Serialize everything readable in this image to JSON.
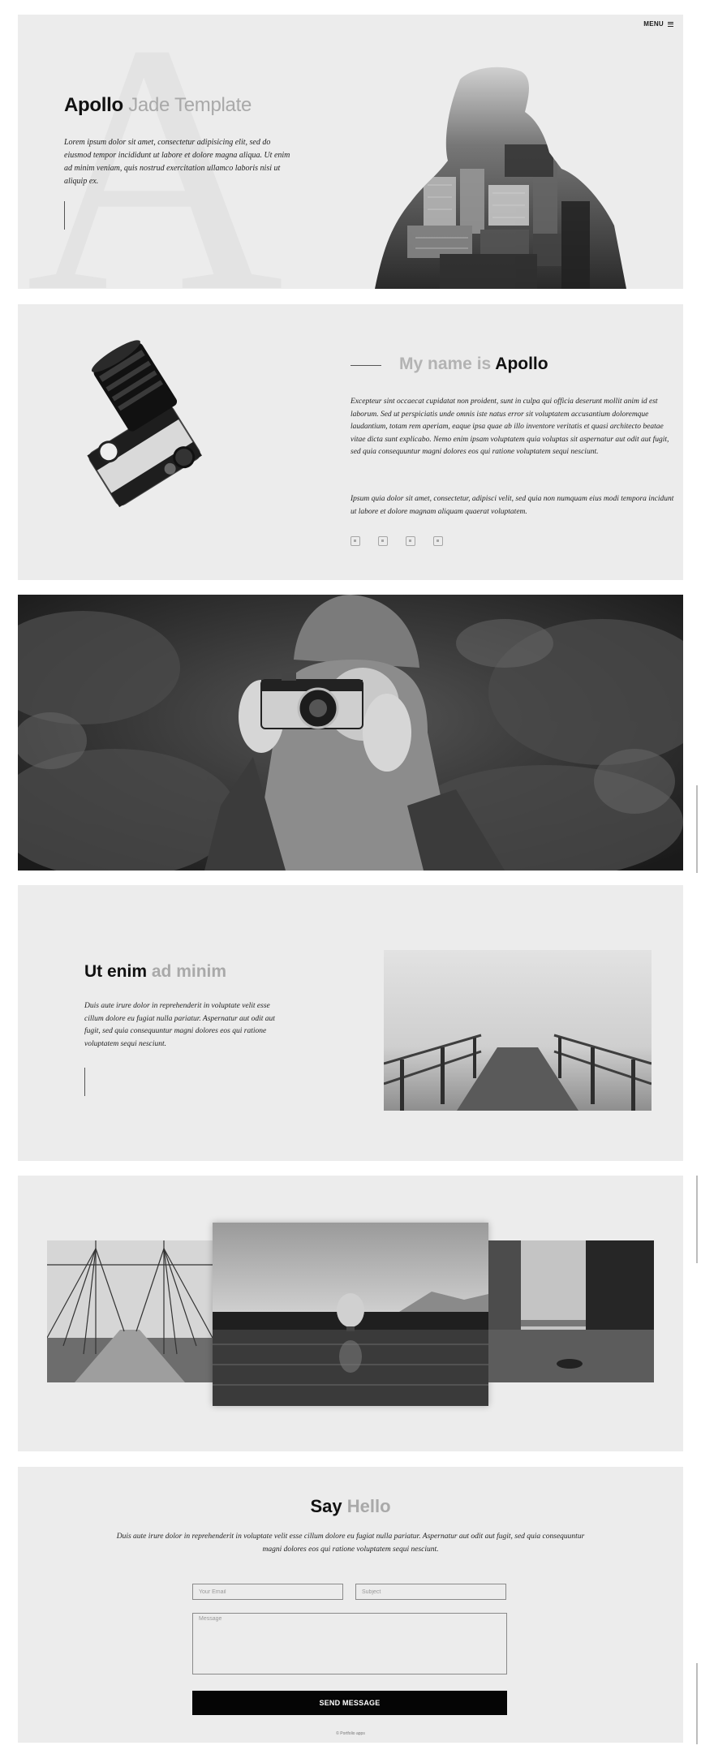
{
  "hero": {
    "menu_label": "MENU",
    "big_letter": "A",
    "title_bold": "Apollo",
    "title_light": "Jade Template",
    "text": "Lorem ipsum dolor sit amet, consectetur adipisicing elit, sed do eiusmod tempor incididunt ut labore et dolore magna aliqua. Ut enim ad minim veniam, quis nostrud exercitation ullamco laboris nisi ut aliquip ex."
  },
  "about": {
    "title_light": "My name is",
    "title_bold": "Apollo",
    "p1": "Excepteur sint occaecat cupidatat non proident, sunt in culpa qui officia deserunt mollit anim id est laborum. Sed ut perspiciatis unde omnis iste natus error sit voluptatem accusantium doloremque laudantium, totam rem aperiam, eaque ipsa quae ab illo inventore veritatis et quasi architecto beatae vitae dicta sunt explicabo. Nemo enim ipsam voluptatem quia voluptas sit aspernatur aut odit aut fugit, sed quia consequuntur magni dolores eos qui ratione voluptatem sequi nesciunt.",
    "p2": "Ipsum quia dolor sit amet, consectetur, adipisci velit, sed quia non numquam eius modi tempora incidunt ut labore et dolore magnam aliquam quaerat voluptatem.",
    "socials": [
      "facebook-icon",
      "instagram-icon",
      "twitter-icon",
      "pinterest-icon"
    ]
  },
  "utenim": {
    "title_bold": "Ut enim",
    "title_light": "ad minim",
    "text": "Duis aute irure dolor in reprehenderit in voluptate velit esse cillum dolore eu fugiat nulla pariatur. Aspernatur aut odit aut fugit, sed quia consequuntur magni dolores eos qui ratione voluptatem sequi nesciunt."
  },
  "contact": {
    "title_bold": "Say",
    "title_light": "Hello",
    "text": "Duis aute irure dolor in reprehenderit in voluptate velit esse cillum dolore eu fugiat nulla pariatur. Aspernatur aut odit aut fugit, sed quia consequuntur magni dolores eos qui ratione voluptatem sequi nesciunt.",
    "email_placeholder": "Your Email",
    "subject_placeholder": "Subject",
    "message_placeholder": "Message",
    "send_label": "SEND MESSAGE",
    "copyright": "© Portfolio apps"
  },
  "colors": {
    "panel": "#ececec",
    "accent": "#050505",
    "muted_text": "#a9a9a9"
  }
}
